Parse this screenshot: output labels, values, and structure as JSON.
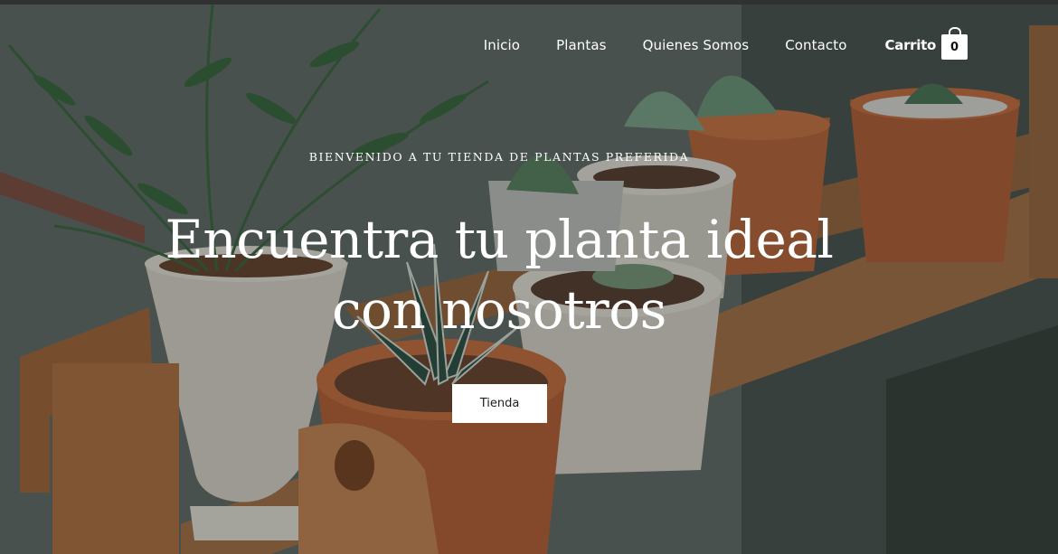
{
  "nav": {
    "links": [
      "Inicio",
      "Plantas",
      "Quienes Somos",
      "Contacto"
    ],
    "cart_label": "Carrito",
    "cart_count": "0"
  },
  "hero": {
    "eyebrow": "BIENVENIDO A TU TIENDA DE PLANTAS PREFERIDA",
    "headline_line1": "Encuentra tu planta ideal",
    "headline_line2": "con nosotros",
    "cta_label": "Tienda"
  },
  "colors": {
    "overlay": "#000000",
    "text": "#ffffff",
    "button_bg": "#ffffff",
    "terracotta": "#b8643a"
  },
  "icons": [
    "shopping-bag-icon"
  ]
}
